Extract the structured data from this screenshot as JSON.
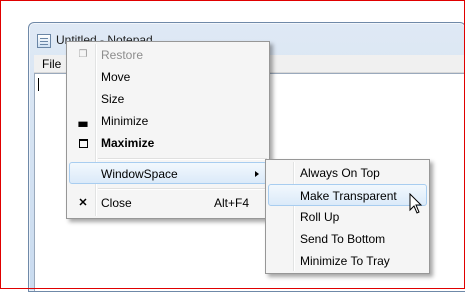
{
  "notepad": {
    "title": "Untitled - Notepad",
    "menu_file": "File"
  },
  "system_menu": {
    "items": [
      {
        "label": "Restore",
        "icon": "restore-icon",
        "disabled": true
      },
      {
        "label": "Move"
      },
      {
        "label": "Size"
      },
      {
        "label": "Minimize",
        "icon": "minimize-icon"
      },
      {
        "label": "Maximize",
        "icon": "maximize-icon",
        "bold": true
      },
      {
        "label": "WindowSpace",
        "has_submenu": true,
        "highlighted": true
      },
      {
        "label": "Close",
        "icon": "close-icon",
        "shortcut": "Alt+F4"
      }
    ]
  },
  "submenu": {
    "items": [
      {
        "label": "Always On Top"
      },
      {
        "label": "Make Transparent",
        "highlighted": true
      },
      {
        "label": "Roll Up"
      },
      {
        "label": "Send To Bottom"
      },
      {
        "label": "Minimize To Tray"
      }
    ]
  },
  "colors": {
    "highlight_border": "#a8cdf0",
    "menu_bg": "#f5f5f5",
    "frame_border": "#e00000"
  }
}
